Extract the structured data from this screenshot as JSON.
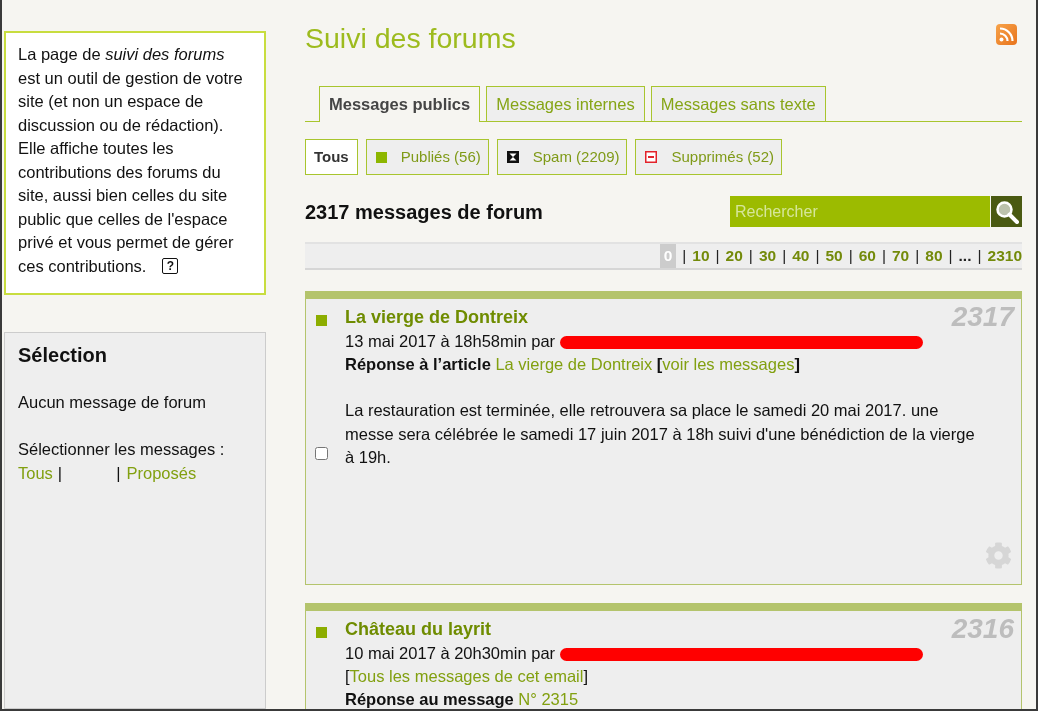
{
  "sidebar": {
    "intro": {
      "text": "La page de *suivi des forums* est un outil de gestion de votre site (et non un espace de discussion ou de rédaction). Elle affiche toutes les contributions des forums du site, aussi bien celles du site public que celles de l'espace privé et vous permet de gérer ces contributions.",
      "help": "?"
    },
    "selection": {
      "title": "Sélection",
      "empty": "Aucun message de forum",
      "prompt": "Sélectionner les messages :",
      "links": [
        {
          "kind": "link",
          "text": "Tous"
        },
        {
          "kind": "separator",
          "text": "|"
        },
        {
          "kind": "separator",
          "text": "|"
        },
        {
          "kind": "link",
          "text": "Proposés"
        }
      ]
    }
  },
  "page": {
    "title": "Suivi des forums"
  },
  "tabs": [
    {
      "label": "Messages publics",
      "selected": true
    },
    {
      "label": "Messages internes",
      "selected": false
    },
    {
      "label": "Messages sans texte",
      "selected": false
    }
  ],
  "filters": [
    {
      "kind": "all",
      "label": "Tous",
      "selected": true
    },
    {
      "kind": "published",
      "label": "Publiés (56)",
      "selected": false
    },
    {
      "kind": "spam",
      "label": "Spam (2209)",
      "selected": false
    },
    {
      "kind": "deleted",
      "label": "Supprimés (52)",
      "selected": false
    }
  ],
  "count": "2317 messages de forum",
  "search": {
    "placeholder": "Rechercher"
  },
  "pagination": [
    {
      "kind": "page",
      "label": "0",
      "selected": true
    },
    {
      "kind": "separator",
      "label": "|"
    },
    {
      "kind": "page",
      "label": "10",
      "selected": false
    },
    {
      "kind": "separator",
      "label": "|"
    },
    {
      "kind": "page",
      "label": "20",
      "selected": false
    },
    {
      "kind": "separator",
      "label": "|"
    },
    {
      "kind": "page",
      "label": "30",
      "selected": false
    },
    {
      "kind": "separator",
      "label": "|"
    },
    {
      "kind": "page",
      "label": "40",
      "selected": false
    },
    {
      "kind": "separator",
      "label": "|"
    },
    {
      "kind": "page",
      "label": "50",
      "selected": false
    },
    {
      "kind": "separator",
      "label": "|"
    },
    {
      "kind": "page",
      "label": "60",
      "selected": false
    },
    {
      "kind": "separator",
      "label": "|"
    },
    {
      "kind": "page",
      "label": "70",
      "selected": false
    },
    {
      "kind": "separator",
      "label": "|"
    },
    {
      "kind": "page",
      "label": "80",
      "selected": false
    },
    {
      "kind": "separator",
      "label": "|"
    },
    {
      "kind": "ellipsis",
      "label": "..."
    },
    {
      "kind": "separator",
      "label": "|"
    },
    {
      "kind": "page",
      "label": "2310",
      "selected": false
    }
  ],
  "messages": [
    {
      "title": "La vierge de Dontreix",
      "number": "2317",
      "date": "13 mai 2017 à 18h58min par",
      "author_redacted": true,
      "reply": {
        "label": "Réponse à l’article",
        "link": "La vierge de Dontreix",
        "open": "[",
        "extra_link": "voir les messages",
        "close": "]"
      },
      "body": "La restauration est terminée, elle retrouvera sa place le samedi 20 mai 2017. une messe sera célébrée le samedi 17 juin 2017 à 18h suivi d'une bénédiction de la vierge à 19h.",
      "checked": false
    },
    {
      "title": "Château du layrit",
      "number": "2316",
      "date": "10 mai 2017 à 20h30min par",
      "author_redacted": true,
      "email": {
        "open": "[",
        "link": "Tous les messages de cet email",
        "close": "]"
      },
      "reply": {
        "label": "Réponse au message",
        "link": "N° 2315"
      }
    }
  ]
}
